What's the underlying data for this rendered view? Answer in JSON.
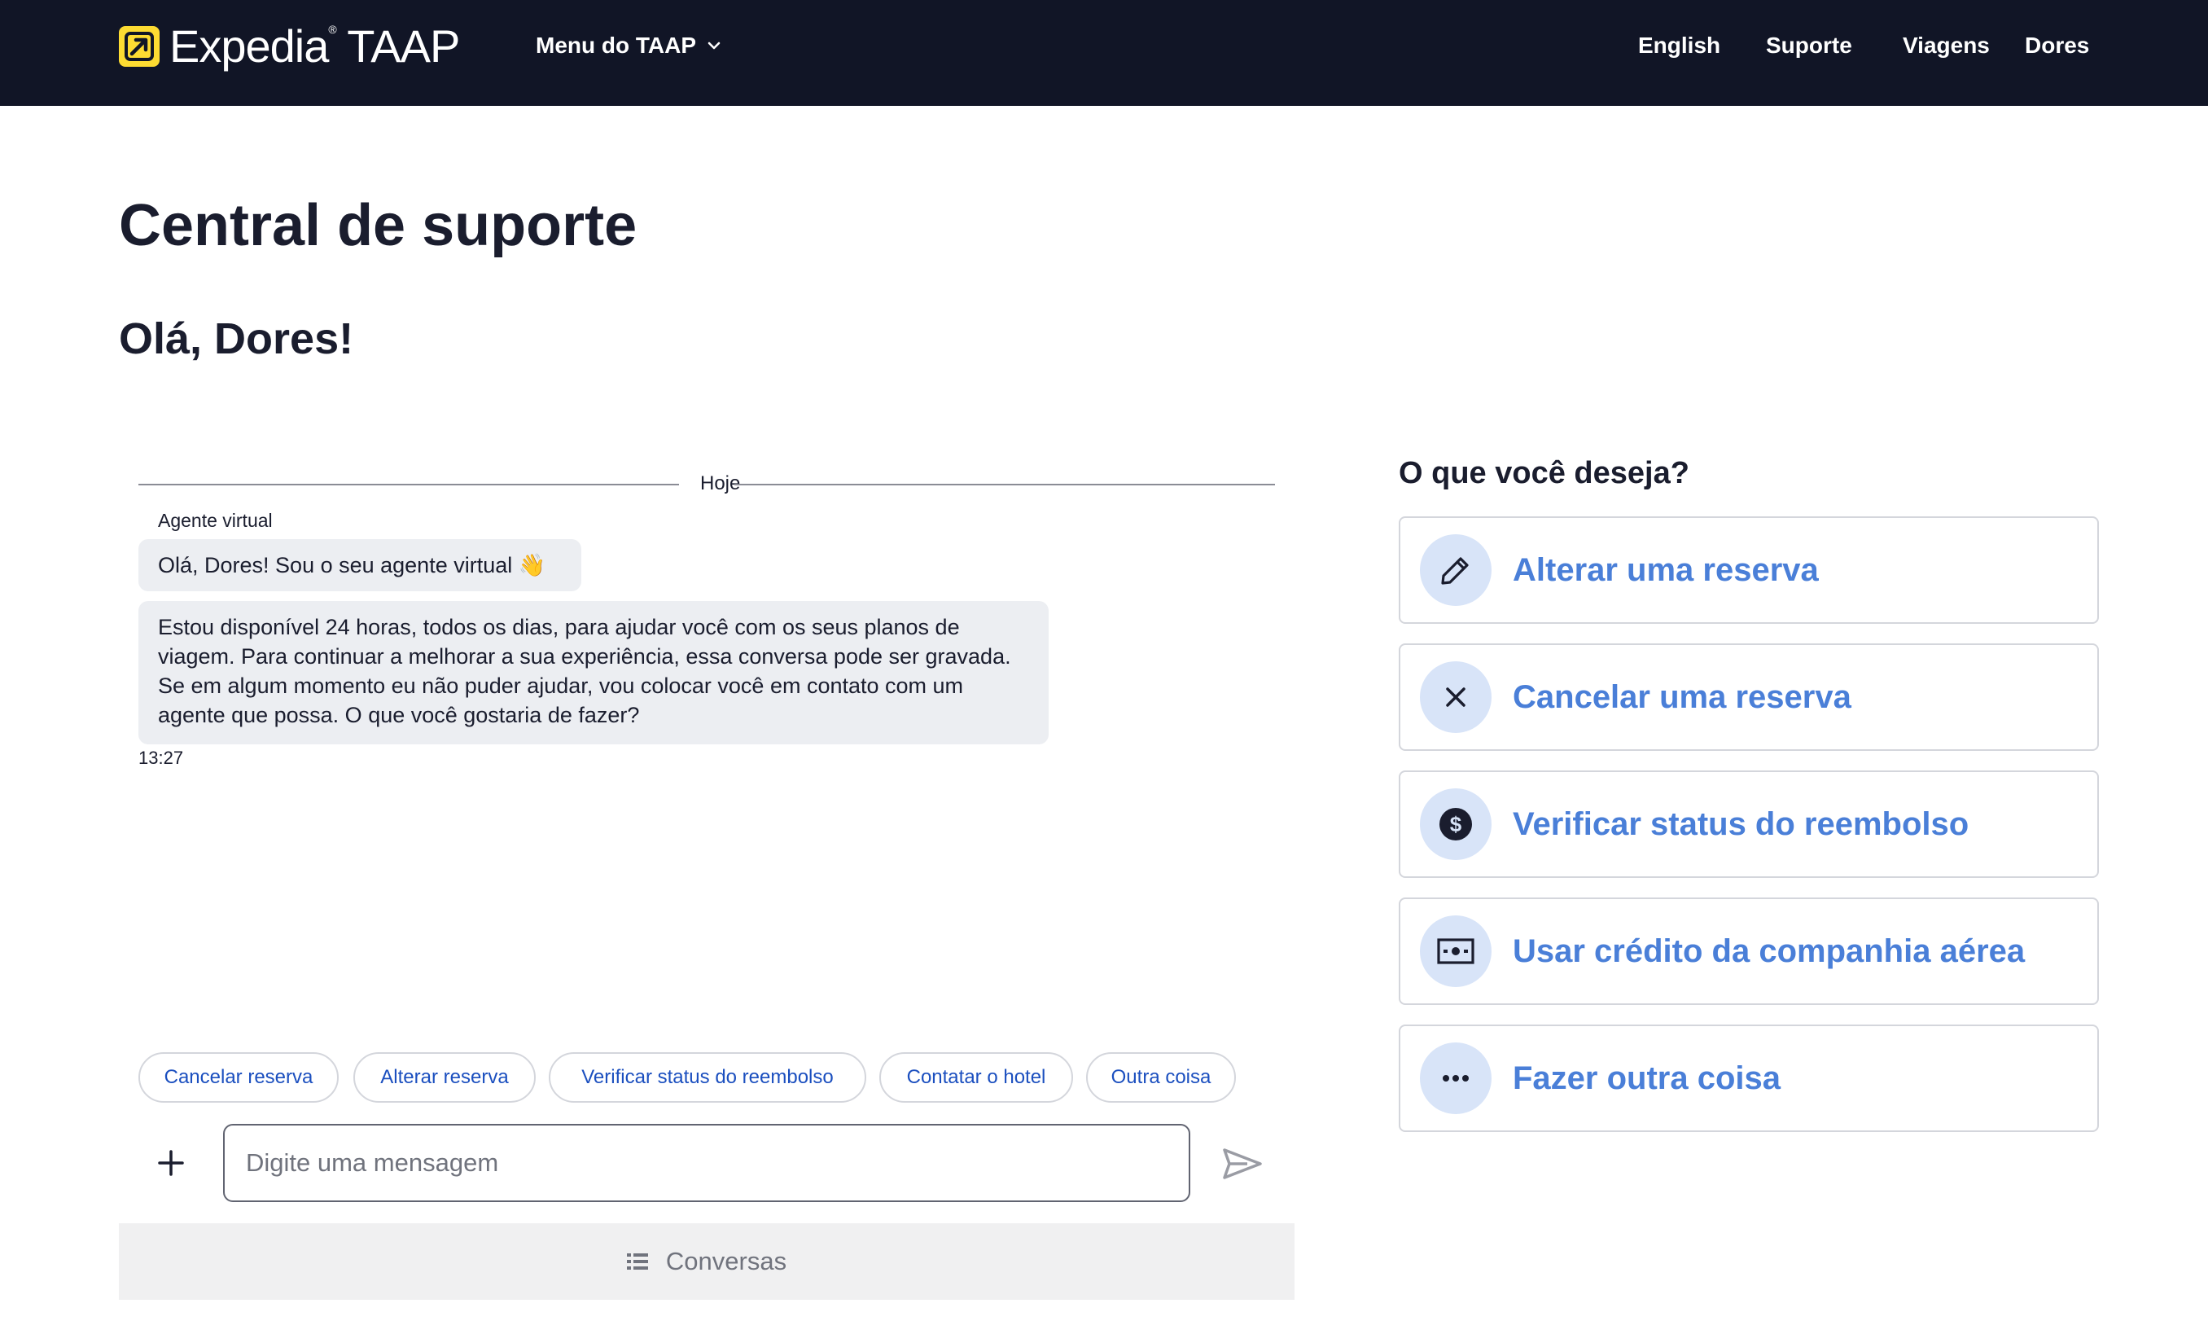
{
  "header": {
    "brand": "Expedia",
    "brand_suffix": "TAAP",
    "menu_label": "Menu do TAAP",
    "nav": [
      "English",
      "Suporte",
      "Viagens",
      "Dores"
    ]
  },
  "page": {
    "title": "Central de suporte",
    "greeting": "Olá, Dores!"
  },
  "chat": {
    "day_label": "Hoje",
    "agent_name": "Agente virtual",
    "messages": [
      "Olá, Dores! Sou o seu agente virtual 👋",
      "Estou disponível 24 horas, todos os dias, para ajudar você com os seus planos de viagem. Para continuar a melhorar a sua experiência, essa conversa pode ser gravada. Se em algum momento eu não puder ajudar, vou colocar você em contato com um agente que possa. O que você gostaria de fazer?"
    ],
    "timestamp": "13:27",
    "quick_replies": [
      "Cancelar reserva",
      "Alterar reserva",
      "Verificar status do reembolso",
      "Contatar o hotel",
      "Outra coisa"
    ],
    "input_placeholder": "Digite uma mensagem",
    "conversations_label": "Conversas"
  },
  "options": {
    "title": "O que você deseja?",
    "items": [
      {
        "label": "Alterar uma reserva",
        "icon": "pencil-icon"
      },
      {
        "label": "Cancelar uma reserva",
        "icon": "close-icon"
      },
      {
        "label": "Verificar status do reembolso",
        "icon": "dollar-icon"
      },
      {
        "label": "Usar crédito da companhia aérea",
        "icon": "cash-icon"
      },
      {
        "label": "Fazer outra coisa",
        "icon": "more-icon"
      }
    ]
  },
  "colors": {
    "header_bg": "#111526",
    "brand_yellow": "#fddb32",
    "link_blue": "#4a7fd8",
    "chip_blue": "#1b4fbf",
    "icon_circle": "#d8e4f8",
    "bubble_bg": "#eceef2"
  }
}
